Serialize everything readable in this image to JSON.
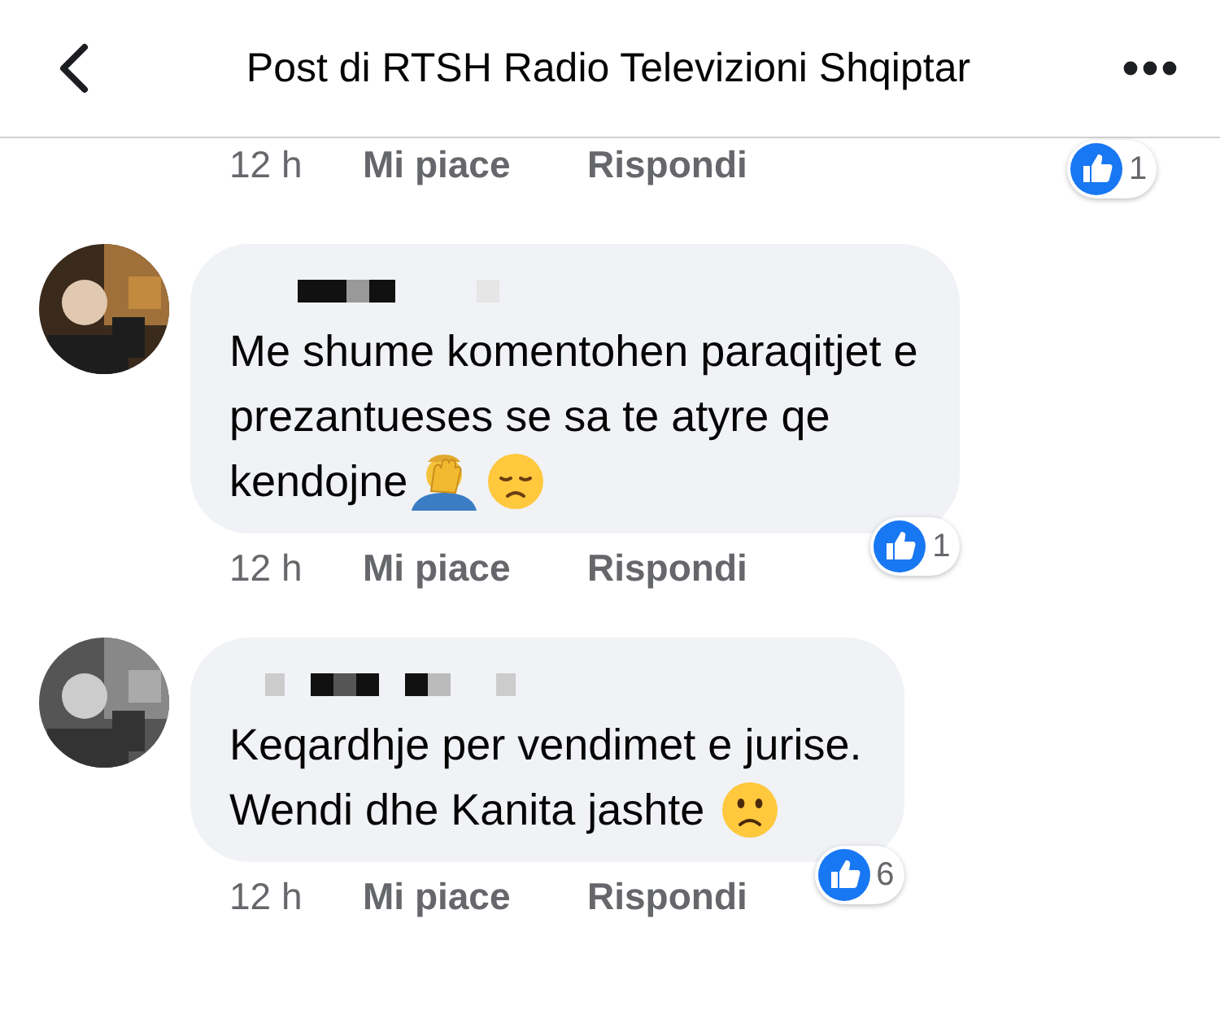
{
  "header": {
    "title": "Post di RTSH Radio Televizioni Shqiptar"
  },
  "top_actions": {
    "time": "12 h",
    "like": "Mi piace",
    "reply": "Rispondi",
    "reaction_count": "1"
  },
  "comments": [
    {
      "avatar": {
        "kind": "picture"
      },
      "lines": [
        "Me shume komentohen paraqitjet e",
        "prezantueses se sa te atyre qe",
        "kendojne"
      ],
      "emoji": [
        {
          "kind": "facepalm"
        },
        {
          "kind": "sad"
        }
      ],
      "time": "12 h",
      "like": "Mi piace",
      "reply": "Rispondi",
      "reaction_count": "1"
    },
    {
      "avatar": {
        "kind": "picture"
      },
      "lines": [
        "Keqardhje per vendimet e jurise.",
        "Wendi dhe Kanita jashte"
      ],
      "emoji": [
        {
          "kind": "frown"
        }
      ],
      "time": "12 h",
      "like": "Mi piace",
      "reply": "Rispondi",
      "reaction_count": "6"
    }
  ]
}
